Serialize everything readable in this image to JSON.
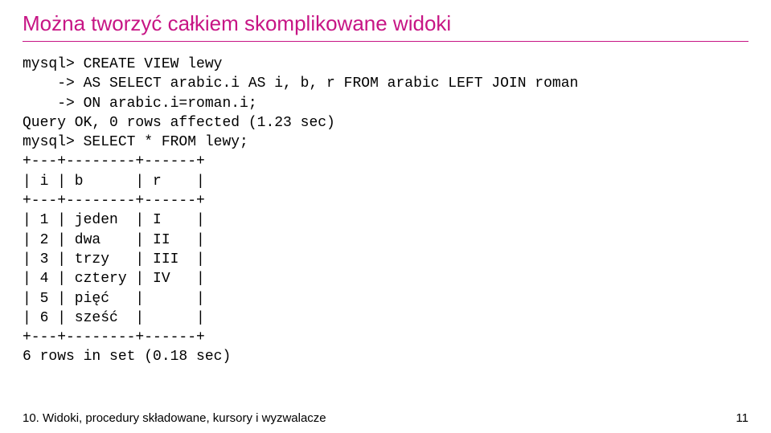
{
  "title": "Można tworzyć całkiem skomplikowane widoki",
  "code": {
    "line1": "mysql> CREATE VIEW lewy",
    "line2": "    -> AS SELECT arabic.i AS i, b, r FROM arabic LEFT JOIN roman",
    "line3": "    -> ON arabic.i=roman.i;",
    "line4": "Query OK, 0 rows affected (1.23 sec)",
    "line5": "mysql> SELECT * FROM lewy;",
    "sep": "+---+--------+------+",
    "header": "| i | b      | r    |",
    "row1": "| 1 | jeden  | I    |",
    "row2": "| 2 | dwa    | II   |",
    "row3": "| 3 | trzy   | III  |",
    "row4": "| 4 | cztery | IV   |",
    "row5": "| 5 | pięć   |      |",
    "row6": "| 6 | sześć  |      |",
    "result": "6 rows in set (0.18 sec)"
  },
  "footer": {
    "left": "10. Widoki, procedury składowane, kursory i wyzwalacze",
    "right": "11"
  },
  "chart_data": {
    "type": "table",
    "title": "SELECT * FROM lewy",
    "columns": [
      "i",
      "b",
      "r"
    ],
    "rows": [
      {
        "i": 1,
        "b": "jeden",
        "r": "I"
      },
      {
        "i": 2,
        "b": "dwa",
        "r": "II"
      },
      {
        "i": 3,
        "b": "trzy",
        "r": "III"
      },
      {
        "i": 4,
        "b": "cztery",
        "r": "IV"
      },
      {
        "i": 5,
        "b": "pięć",
        "r": null
      },
      {
        "i": 6,
        "b": "sześć",
        "r": null
      }
    ],
    "query_time_sec": 0.18,
    "create_time_sec": 1.23,
    "row_count": 6
  }
}
